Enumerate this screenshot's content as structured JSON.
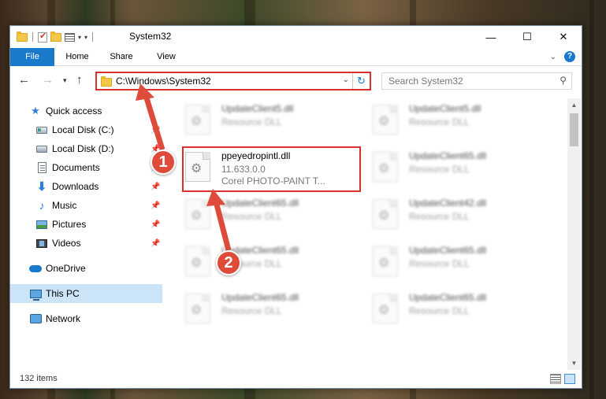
{
  "window": {
    "title": "System32",
    "controls": [
      "—",
      "☐",
      "✕"
    ]
  },
  "ribbon": {
    "tabs": [
      "File",
      "Home",
      "Share",
      "View"
    ]
  },
  "nav": {
    "address": "C:\\Windows\\System32",
    "search_placeholder": "Search System32"
  },
  "sidebar": {
    "items": [
      {
        "label": "Quick access",
        "icon": "star-icon"
      },
      {
        "label": "Local Disk (C:)",
        "icon": "drive-icon",
        "pinned": true
      },
      {
        "label": "Local Disk (D:)",
        "icon": "drive-icon",
        "pinned": true
      },
      {
        "label": "Documents",
        "icon": "documents-icon",
        "pinned": true
      },
      {
        "label": "Downloads",
        "icon": "downloads-icon",
        "pinned": true
      },
      {
        "label": "Music",
        "icon": "music-icon",
        "pinned": true
      },
      {
        "label": "Pictures",
        "icon": "pictures-icon",
        "pinned": true
      },
      {
        "label": "Videos",
        "icon": "videos-icon",
        "pinned": true
      },
      {
        "label": "OneDrive",
        "icon": "cloud-icon"
      },
      {
        "label": "This PC",
        "icon": "computer-icon",
        "selected": true
      },
      {
        "label": "Network",
        "icon": "network-icon"
      }
    ]
  },
  "files": {
    "left": [
      {
        "name": "UpdateClient5.dll",
        "type": "Resource DLL"
      },
      {
        "name": "ppeyedropintl.dll",
        "type": "11.633.0.0",
        "desc": "Corel PHOTO-PAINT T..."
      },
      {
        "name": "UpdateClient65.dll",
        "type": "Resource DLL"
      },
      {
        "name": "UpdateClient65.dll",
        "type": "Resource DLL"
      },
      {
        "name": "UpdateClient65.dll",
        "type": "Resource DLL"
      }
    ],
    "right": [
      {
        "name": "UpdateClient5.dll",
        "type": "Resource DLL"
      },
      {
        "name": "UpdateClient65.dll",
        "type": "Resource DLL"
      },
      {
        "name": "UpdateClient42.dll",
        "type": "Resource DLL"
      },
      {
        "name": "UpdateClient65.dll",
        "type": "Resource DLL"
      },
      {
        "name": "UpdateClient65.dll",
        "type": "Resource DLL"
      }
    ]
  },
  "status": {
    "item_count": "132 items"
  },
  "annotations": {
    "marker_1": "1",
    "marker_2": "2",
    "color": "#de4b3a"
  }
}
